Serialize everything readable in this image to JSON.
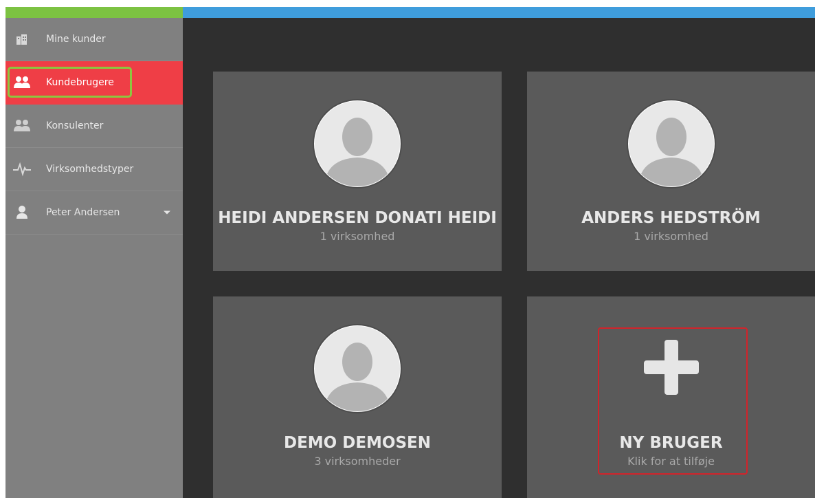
{
  "sidebar": {
    "items": [
      {
        "label": "Mine kunder",
        "icon": "buildings-icon",
        "active": false
      },
      {
        "label": "Kundebrugere",
        "icon": "users-icon",
        "active": true
      },
      {
        "label": "Konsulenter",
        "icon": "consultants-icon",
        "active": false
      },
      {
        "label": "Virksomhedstyper",
        "icon": "pulse-icon",
        "active": false
      },
      {
        "label": "Peter Andersen",
        "icon": "user-icon",
        "active": false
      }
    ]
  },
  "cards": [
    {
      "name": "HEIDI ANDERSEN DONATI HEIDI",
      "sub": "1 virksomhed",
      "icon": "avatar-icon"
    },
    {
      "name": "ANDERS HEDSTRÖM",
      "sub": "1 virksomhed",
      "icon": "avatar-icon"
    },
    {
      "name": "DEMO DEMOSEN",
      "sub": "3 virksomheder",
      "icon": "avatar-icon"
    },
    {
      "name": "NY BRUGER",
      "sub": "Klik for at tilføje",
      "icon": "plus-icon"
    }
  ],
  "colors": {
    "top_bar_green": "#7cc242",
    "top_bar_blue": "#3f9ddc",
    "sidebar_bg": "#808080",
    "active_item": "#ef3e46",
    "main_bg": "#2f2f2f",
    "card_bg": "#5a5a5a",
    "highlight_green": "#8dc63f",
    "highlight_red": "#d2232a"
  }
}
